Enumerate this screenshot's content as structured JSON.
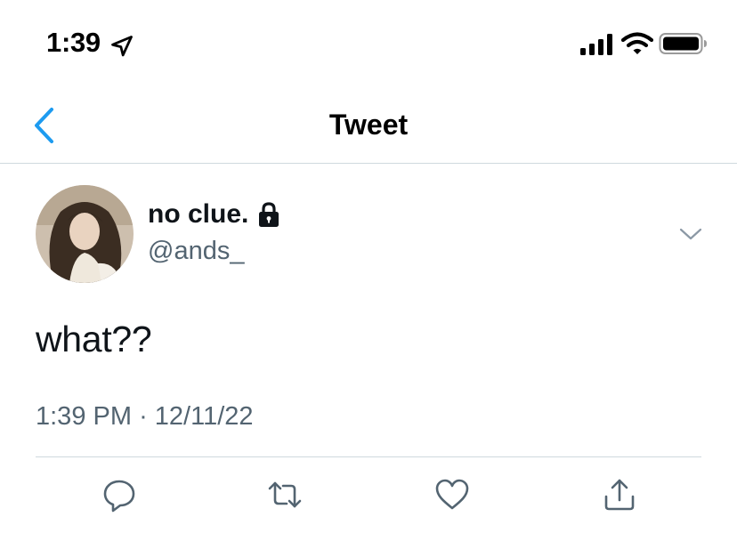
{
  "status_bar": {
    "time": "1:39"
  },
  "nav": {
    "title": "Tweet",
    "back_icon": "chevron-left-icon"
  },
  "tweet": {
    "author": {
      "display_name": "no clue.",
      "handle": "@ands_",
      "protected_icon": "lock-icon"
    },
    "text": "what??",
    "time": "1:39 PM",
    "separator": "·",
    "date": "12/11/22"
  },
  "actions": [
    {
      "name": "reply",
      "icon": "reply-icon"
    },
    {
      "name": "retweet",
      "icon": "retweet-icon"
    },
    {
      "name": "like",
      "icon": "heart-icon"
    },
    {
      "name": "share",
      "icon": "share-icon"
    }
  ],
  "colors": {
    "accent": "#1d9bf0",
    "text_primary": "#0f1419",
    "text_secondary": "#536471",
    "divider": "#cfd9de"
  }
}
